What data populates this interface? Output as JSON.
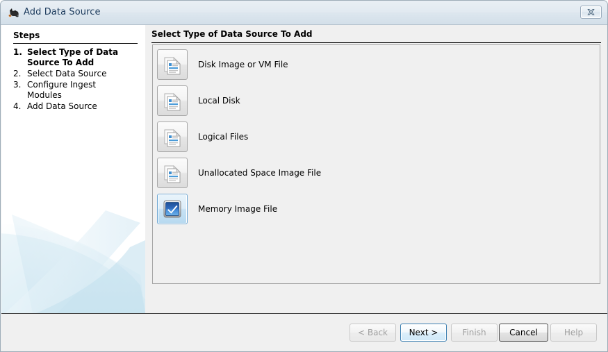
{
  "window": {
    "title": "Add Data Source",
    "icon": "autopsy-logo-icon",
    "close_label": "×"
  },
  "steps": {
    "heading": "Steps",
    "items": [
      {
        "num": "1.",
        "label": "Select Type of Data Source To Add",
        "current": true
      },
      {
        "num": "2.",
        "label": "Select Data Source",
        "current": false
      },
      {
        "num": "3.",
        "label": "Configure Ingest Modules",
        "current": false
      },
      {
        "num": "4.",
        "label": "Add Data Source",
        "current": false
      }
    ]
  },
  "content": {
    "heading": "Select Type of Data Source To Add",
    "sources": [
      {
        "label": "Disk Image or VM File",
        "icon": "document-stack-icon",
        "selected": false
      },
      {
        "label": "Local Disk",
        "icon": "document-stack-icon",
        "selected": false
      },
      {
        "label": "Logical Files",
        "icon": "document-stack-icon",
        "selected": false
      },
      {
        "label": "Unallocated Space Image File",
        "icon": "document-stack-icon",
        "selected": false
      },
      {
        "label": "Memory Image File",
        "icon": "blue-checkbox-icon",
        "selected": true
      }
    ]
  },
  "buttons": {
    "back": "< Back",
    "next": "Next >",
    "finish": "Finish",
    "cancel": "Cancel",
    "help": "Help"
  },
  "colors": {
    "accent": "#3c7fb1",
    "titlebar": "#e2eaf1",
    "panel": "#f0f0f0",
    "selection": "#b7d9f0"
  }
}
